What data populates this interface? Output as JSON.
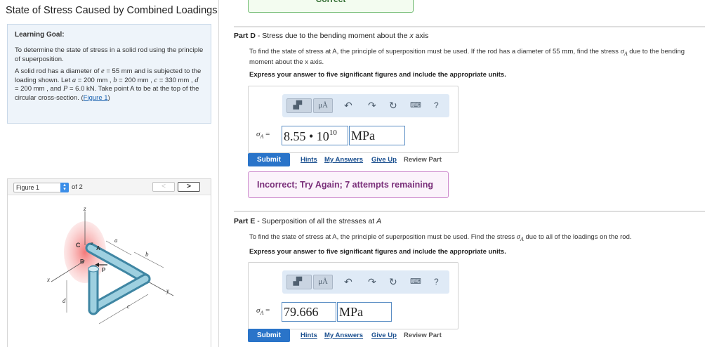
{
  "page_title": "State of Stress Caused by Combined Loadings",
  "learning_goal": {
    "heading": "Learning Goal:",
    "goal_text": "To determine the state of stress in a solid rod using the principle of superposition.",
    "p1": "A solid rod has a diameter of",
    "e_sym": "e",
    "e_val": " = 55 mm and is subjected to the loading shown. Let",
    "a_sym": "a",
    "a_val": " = 200 mm ,",
    "b_sym": "b",
    "b_val": " = 200 mm ,",
    "c_sym": "c",
    "c_val": " = 330 mm ,",
    "d_sym": "d",
    "d_val": " = 200 mm , and",
    "P_sym": "P",
    "P_val": " = 6.0 kN",
    "p2": ". Take point A to be at the top of the circular cross-section. (",
    "fig_link": "Figure 1",
    "p3": ")"
  },
  "figure": {
    "select_value": "Figure 1",
    "of_text": "of 2",
    "prev": "<",
    "next": ">",
    "labels": {
      "z": "z",
      "a": "a",
      "b": "b",
      "c": "c",
      "d": "d",
      "x": "x",
      "y": "y",
      "C": "C",
      "B": "B",
      "A": "A",
      "e": "e",
      "P": "P"
    }
  },
  "previous_status": "Correct",
  "part_d": {
    "label": "Part D",
    "title_sep": " - ",
    "title_text": "Stress due to the bending moment about the",
    "title_axis": "x",
    "title_end": "axis",
    "para_1": "To find the state of stress at A, the principle of superposition must be used. If the rod has a diameter of 55",
    "para_unit": "mm",
    "para_2": ", find the stress",
    "para_sigma": "σ",
    "para_sub": "A",
    "para_3": "due to the bending moment about the x axis.",
    "instruction": "Express your answer to five significant figures and include the appropriate units.",
    "sigma_label": "σ",
    "sigma_sub": "A",
    "sigma_eq": " =",
    "value_mantissa": "8.55 • 10",
    "value_exponent": "10",
    "unit": "MPa",
    "feedback": "Incorrect; Try Again; 7 attempts remaining"
  },
  "part_e": {
    "label": "Part E",
    "title_sep": " - ",
    "title_text": "Superposition of all the stresses at",
    "title_pt": "A",
    "para_1": "To find the state of stress at A, the principle of superposition must be used. Find the stress",
    "para_sigma": "σ",
    "para_sub": "A",
    "para_2": "due to all of the loadings on the rod.",
    "instruction": "Express your answer to five significant figures and include the appropriate units.",
    "sigma_label": "σ",
    "sigma_sub": "A",
    "sigma_eq": " =",
    "value": "79.666",
    "unit": "MPa"
  },
  "toolbar": {
    "templates_icon": "templates-icon",
    "units_label": "μÅ",
    "undo_icon": "↶",
    "redo_icon": "↷",
    "reset_icon": "↻",
    "keyboard_icon": "keyboard-icon",
    "help_label": "?"
  },
  "actions": {
    "submit": "Submit",
    "hints": "Hints",
    "my_answers": "My Answers",
    "give_up": "Give Up",
    "review_part": "Review Part"
  },
  "colors": {
    "accent": "#2a74c9",
    "correct": "#6bb86b",
    "incorrect": "#cc88cc"
  }
}
